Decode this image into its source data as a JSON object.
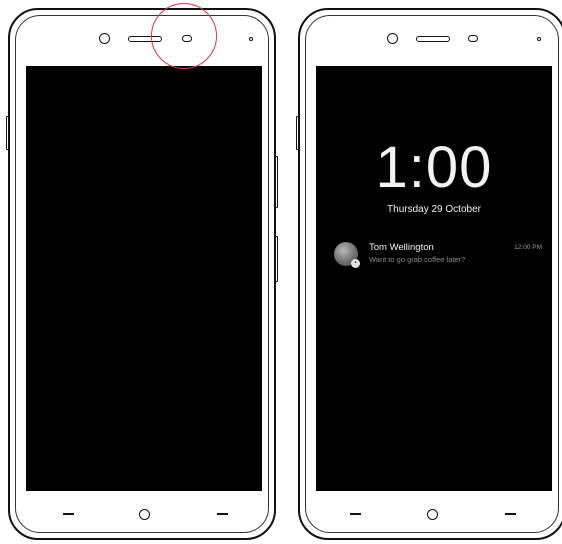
{
  "lock_screen": {
    "clock": "1:00",
    "date": "Thursday 29 October"
  },
  "notification": {
    "sender": "Tom Wellington",
    "message": "Want to go grab coffee later?",
    "time": "12:00 PM",
    "avatar_icon": "person-photo-icon",
    "badge_icon": "message-badge-icon"
  },
  "colors": {
    "screen": "#000000",
    "text": "#f2f2f2",
    "highlight": "#e1314a"
  }
}
